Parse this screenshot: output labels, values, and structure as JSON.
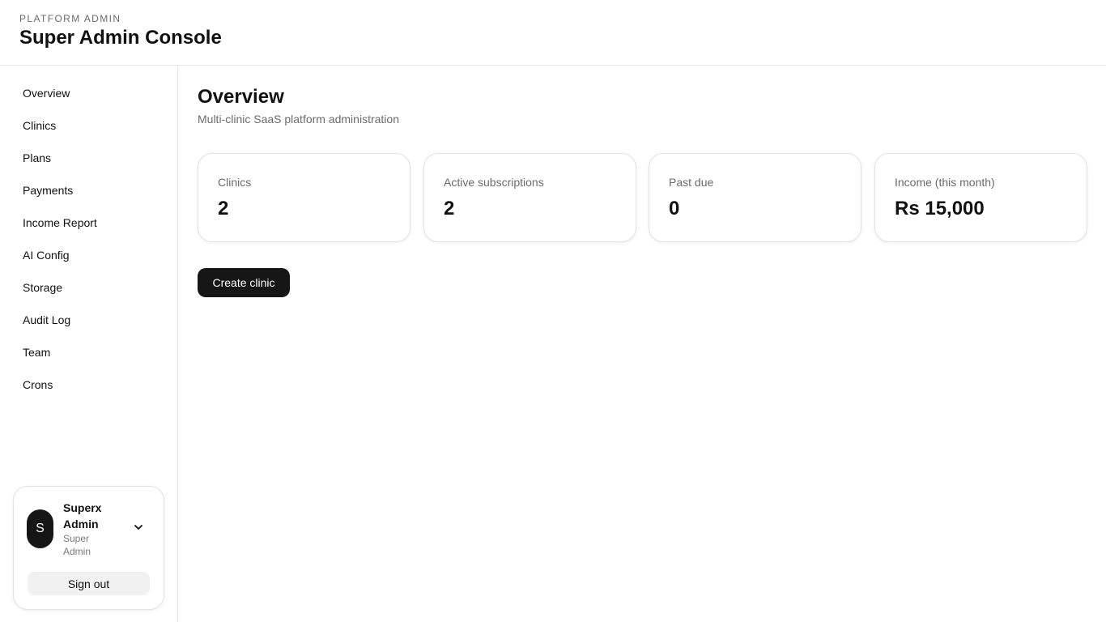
{
  "header": {
    "eyebrow": "PLATFORM ADMIN",
    "title": "Super Admin Console"
  },
  "sidebar": {
    "items": [
      {
        "label": "Overview"
      },
      {
        "label": "Clinics"
      },
      {
        "label": "Plans"
      },
      {
        "label": "Payments"
      },
      {
        "label": "Income Report"
      },
      {
        "label": "AI Config"
      },
      {
        "label": "Storage"
      },
      {
        "label": "Audit Log"
      },
      {
        "label": "Team"
      },
      {
        "label": "Crons"
      }
    ],
    "user": {
      "initial": "S",
      "name": "Superx Admin",
      "role": "Super Admin",
      "menu_icon": "chevron-down-icon",
      "signout_label": "Sign out"
    }
  },
  "main": {
    "title": "Overview",
    "subtitle": "Multi-clinic SaaS platform administration",
    "stats": [
      {
        "label": "Clinics",
        "value": "2"
      },
      {
        "label": "Active subscriptions",
        "value": "2"
      },
      {
        "label": "Past due",
        "value": "0"
      },
      {
        "label": "Income (this month)",
        "value": "Rs 15,000"
      }
    ],
    "create_label": "Create clinic"
  },
  "colors": {
    "primary_button": "#161616",
    "border": "#e5e5e5",
    "muted_text": "#6b6b6b"
  }
}
